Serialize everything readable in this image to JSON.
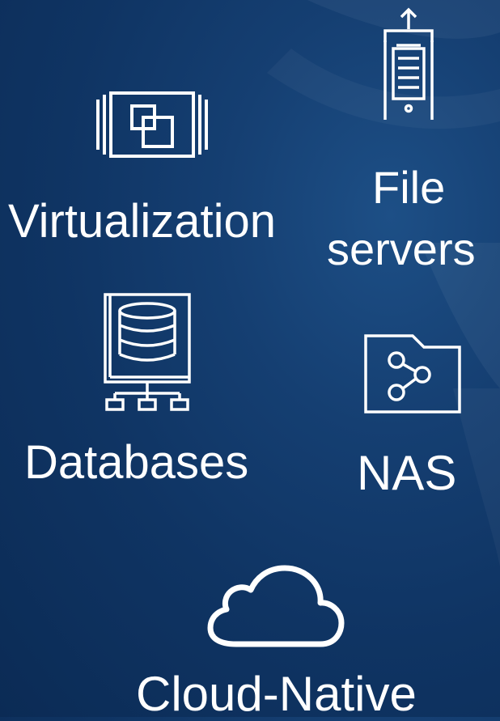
{
  "tiles": {
    "virtualization": {
      "label": "Virtualization",
      "icon": "virtualization-icon"
    },
    "file_servers": {
      "label_line1": "File",
      "label_line2": "servers",
      "icon": "file-server-icon"
    },
    "databases": {
      "label": "Databases",
      "icon": "database-icon"
    },
    "nas": {
      "label": "NAS",
      "icon": "nas-share-folder-icon"
    },
    "cloud_native": {
      "label": "Cloud-Native",
      "icon": "cloud-icon"
    }
  },
  "colors": {
    "background": "#0f3463",
    "foreground": "#ffffff"
  }
}
